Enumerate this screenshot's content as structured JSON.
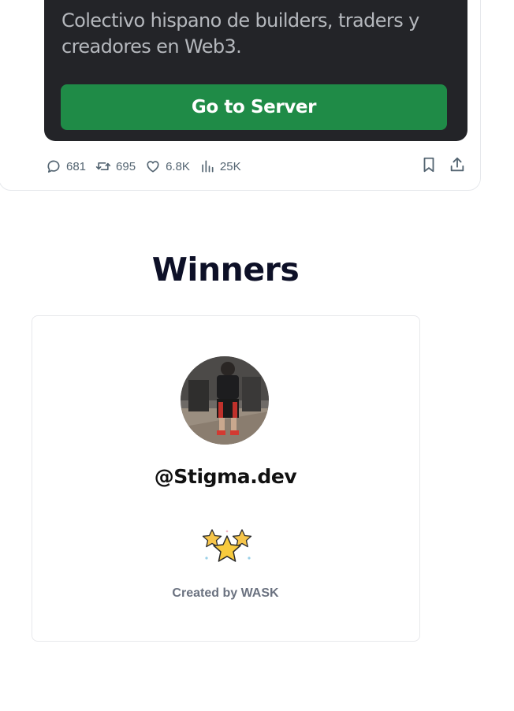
{
  "tweet": {
    "embed_description": "Colectivo hispano de builders, traders y creadores en Web3.",
    "go_button_label": "Go to Server",
    "stats": {
      "replies": "681",
      "reposts": "695",
      "likes": "6.8K",
      "views": "25K"
    }
  },
  "winners": {
    "heading": "Winners",
    "handle": "@Stigma.dev",
    "credit": "Created by WASK"
  },
  "colors": {
    "embed_bg": "#232428",
    "button_green": "#1f8b47",
    "heading": "#0d1027",
    "muted": "#6b7280"
  },
  "icons": [
    "reply-icon",
    "repost-icon",
    "like-icon",
    "views-icon",
    "bookmark-icon",
    "share-icon",
    "stars-icon"
  ]
}
